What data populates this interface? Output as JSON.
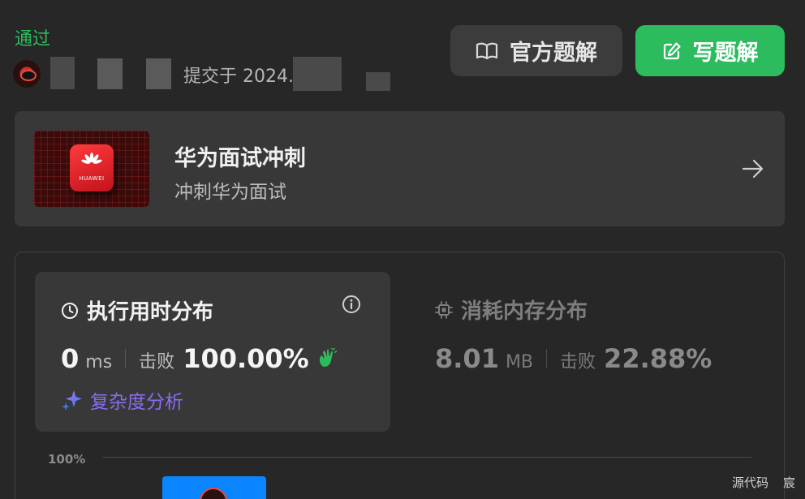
{
  "submission": {
    "status": "通过",
    "submitted_prefix": "提交于 2024."
  },
  "actions": {
    "official_solution": "官方题解",
    "write_solution": "写题解"
  },
  "promo": {
    "title": "华为面试冲刺",
    "subtitle": "冲刺华为面试",
    "logo_text": "HUAWEI"
  },
  "runtime": {
    "title": "执行用时分布",
    "value": "0",
    "unit": "ms",
    "beat_label": "击败",
    "beat_percent": "100.00%",
    "analysis_label": "复杂度分析"
  },
  "memory": {
    "title": "消耗内存分布",
    "value": "8.01",
    "unit": "MB",
    "beat_label": "击败",
    "beat_percent": "22.88%"
  },
  "chart": {
    "y_label_top": "100%"
  },
  "footer": {
    "source_code": "源代码",
    "author": "宸"
  },
  "colors": {
    "accent_green": "#2cbb5d",
    "bar_blue": "#0a84ff",
    "analysis_purple": "#8a6cf0"
  }
}
